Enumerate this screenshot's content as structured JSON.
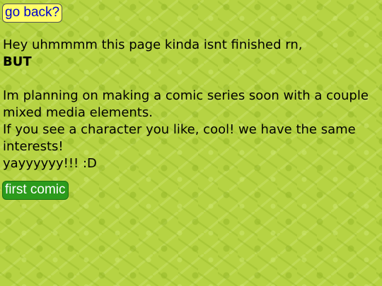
{
  "nav": {
    "back_label": "go back?"
  },
  "main": {
    "line1": "Hey uhmmmm this page kinda isnt finished rn,",
    "line2": "BUT",
    "line3": "Im planning on making a comic series soon with a couple mixed media elements.",
    "line4": "If you see a character you like, cool! we have the same interests!",
    "line5": "yayyyyyy!!! :D",
    "comic_button_label": "first comic"
  },
  "colors": {
    "background": "#b6d343",
    "back_button_bg": "#ffff66",
    "back_button_text": "#0000cc",
    "comic_button_bg": "#2b9b1c",
    "comic_button_text": "#ffffff"
  }
}
